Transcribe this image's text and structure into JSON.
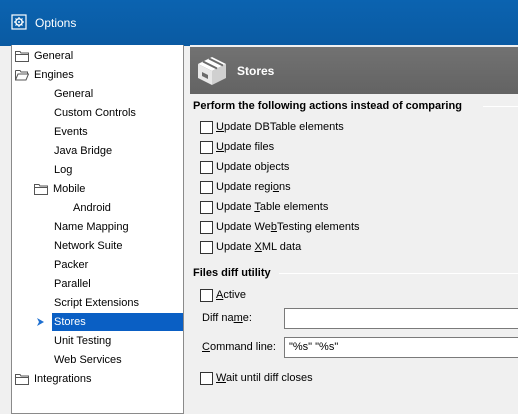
{
  "window": {
    "title": "Options",
    "icon": "options-gear-icon"
  },
  "tree": {
    "items": [
      {
        "label": "General",
        "level": 0,
        "icon": "folder-icon"
      },
      {
        "label": "Engines",
        "level": 0,
        "icon": "folder-open-icon"
      },
      {
        "label": "General",
        "level": 1
      },
      {
        "label": "Custom Controls",
        "level": 1
      },
      {
        "label": "Events",
        "level": 1
      },
      {
        "label": "Java Bridge",
        "level": 1
      },
      {
        "label": "Log",
        "level": 1
      },
      {
        "label": "Mobile",
        "level": 1,
        "icon": "folder-icon"
      },
      {
        "label": "Android",
        "level": 2
      },
      {
        "label": "Name Mapping",
        "level": 1
      },
      {
        "label": "Network Suite",
        "level": 1
      },
      {
        "label": "Packer",
        "level": 1
      },
      {
        "label": "Parallel",
        "level": 1
      },
      {
        "label": "Script Extensions",
        "level": 1
      },
      {
        "label": "Stores",
        "level": 1,
        "selected": true
      },
      {
        "label": "Unit Testing",
        "level": 1
      },
      {
        "label": "Web Services",
        "level": 1
      },
      {
        "label": "Integrations",
        "level": 0,
        "icon": "folder-icon"
      }
    ]
  },
  "header": {
    "title": "Stores",
    "icon": "stores-box-icon"
  },
  "actions_section": {
    "title": "Perform the following actions instead of comparing",
    "options": [
      {
        "pre": "",
        "key": "U",
        "post": "pdate DBTable elements",
        "checked": false
      },
      {
        "pre": "",
        "key": "U",
        "post": "pdate files",
        "checked": false
      },
      {
        "pre": "Update ob",
        "key": "j",
        "post": "ects",
        "checked": false
      },
      {
        "pre": "Update regi",
        "key": "o",
        "post": "ns",
        "checked": false
      },
      {
        "pre": "Update ",
        "key": "T",
        "post": "able elements",
        "checked": false
      },
      {
        "pre": "Update We",
        "key": "b",
        "post": "Testing elements",
        "checked": false
      },
      {
        "pre": "Update ",
        "key": "X",
        "post": "ML data",
        "checked": false
      }
    ]
  },
  "diff_section": {
    "title": "Files diff utility",
    "active": {
      "pre": "",
      "key": "A",
      "post": "ctive",
      "checked": false
    },
    "diff_name": {
      "pre": "Diff na",
      "key": "m",
      "post": "e:",
      "value": ""
    },
    "command_line": {
      "pre": "",
      "key": "C",
      "post": "ommand line:",
      "value": "\"%s\" \"%s\""
    },
    "wait": {
      "pre": "",
      "key": "W",
      "post": "ait until diff closes",
      "checked": false
    }
  },
  "colors": {
    "titlebar": "#0a5fa8",
    "selection": "#0a5fc4",
    "header": "#6b6b6b",
    "arrow": "#1e6fd0"
  }
}
